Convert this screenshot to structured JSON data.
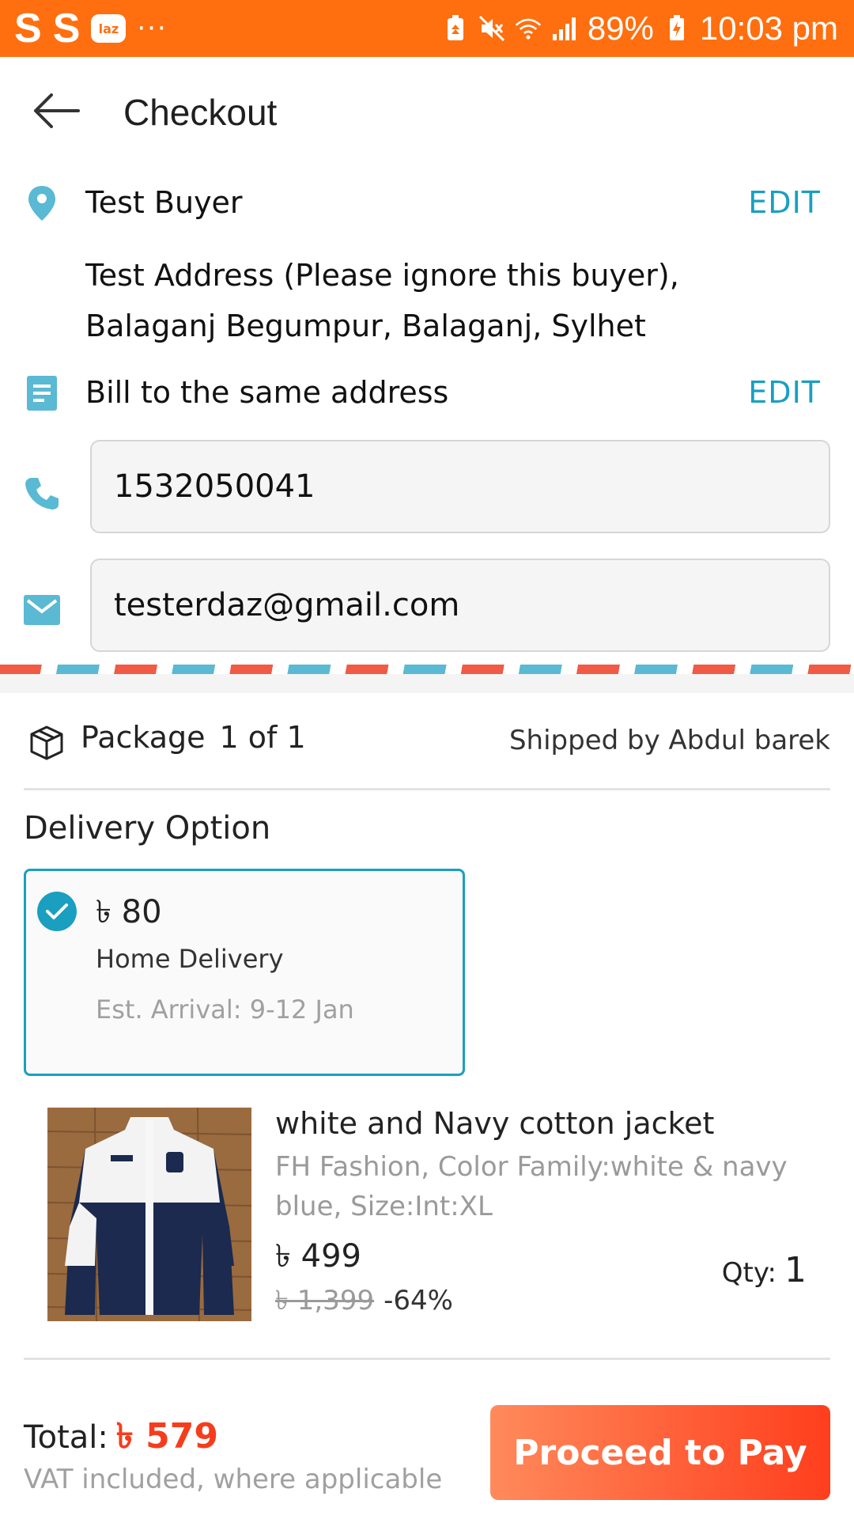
{
  "status_bar": {
    "left_glyphs": [
      "S",
      "S"
    ],
    "app_badge": "laz",
    "overflow": "···",
    "battery": "89%",
    "time": "10:03 pm",
    "icons": [
      "battery-saver-icon",
      "mute-icon",
      "wifi-icon",
      "signal-icon",
      "charging-icon"
    ]
  },
  "header": {
    "title": "Checkout",
    "back_icon": "arrow-left-icon"
  },
  "shipping": {
    "name": "Test Buyer",
    "edit_label": "EDIT",
    "address_line1": "Test Address (Please ignore this buyer),",
    "address_line2": "Balaganj Begumpur, Balaganj, Sylhet"
  },
  "billing": {
    "label": "Bill to the same address",
    "edit_label": "EDIT"
  },
  "contact": {
    "phone": "1532050041",
    "email": "testerdaz@gmail.com"
  },
  "package": {
    "label": "Package",
    "count": "1 of 1",
    "shipped_by": "Shipped by Abdul barek"
  },
  "delivery": {
    "title": "Delivery Option",
    "price": "৳ 80",
    "method": "Home Delivery",
    "eta": "Est. Arrival: 9-12 Jan"
  },
  "product": {
    "name": "white and Navy cotton jacket",
    "variant": "FH Fashion, Color Family:white & navy blue, Size:Int:XL",
    "price": "৳ 499",
    "original_price": "৳ 1,399",
    "discount": "-64%",
    "qty_label": "Qty:",
    "qty": "1"
  },
  "footer": {
    "total_label": "Total:",
    "total_amount": "৳ 579",
    "vat_note": "VAT included, where applicable",
    "pay_label": "Proceed to Pay"
  },
  "colors": {
    "status_bar": "#ff6f0f",
    "accent": "#1a9fc0",
    "price_red": "#f53d1d",
    "pay_button": "#ff4f28"
  }
}
